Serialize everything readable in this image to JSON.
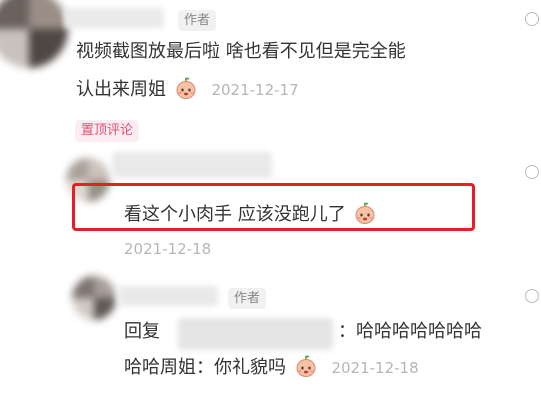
{
  "comment_main": {
    "author_tag": "作者",
    "text_line1": "视频截图放最后啦 啥也看不见但是完全能",
    "text_line2": "认出来周姐",
    "date": "2021-12-17",
    "pinned_label": "置顶评论"
  },
  "reply_1": {
    "text": "看这个小肉手 应该没跑儿了",
    "date": "2021-12-18"
  },
  "reply_2": {
    "author_tag": "作者",
    "reply_prefix": "回复",
    "text_line1_tail": "：哈哈哈哈哈哈哈",
    "text_line2": "哈哈周姐：你礼貌吗",
    "date": "2021-12-18"
  },
  "emoji_name": "peach-face-emoji",
  "colors": {
    "highlight": "#e61e25",
    "pinned_text": "#e2516e",
    "pinned_bg": "#fdecf1",
    "date_text": "#b6b6b6"
  }
}
